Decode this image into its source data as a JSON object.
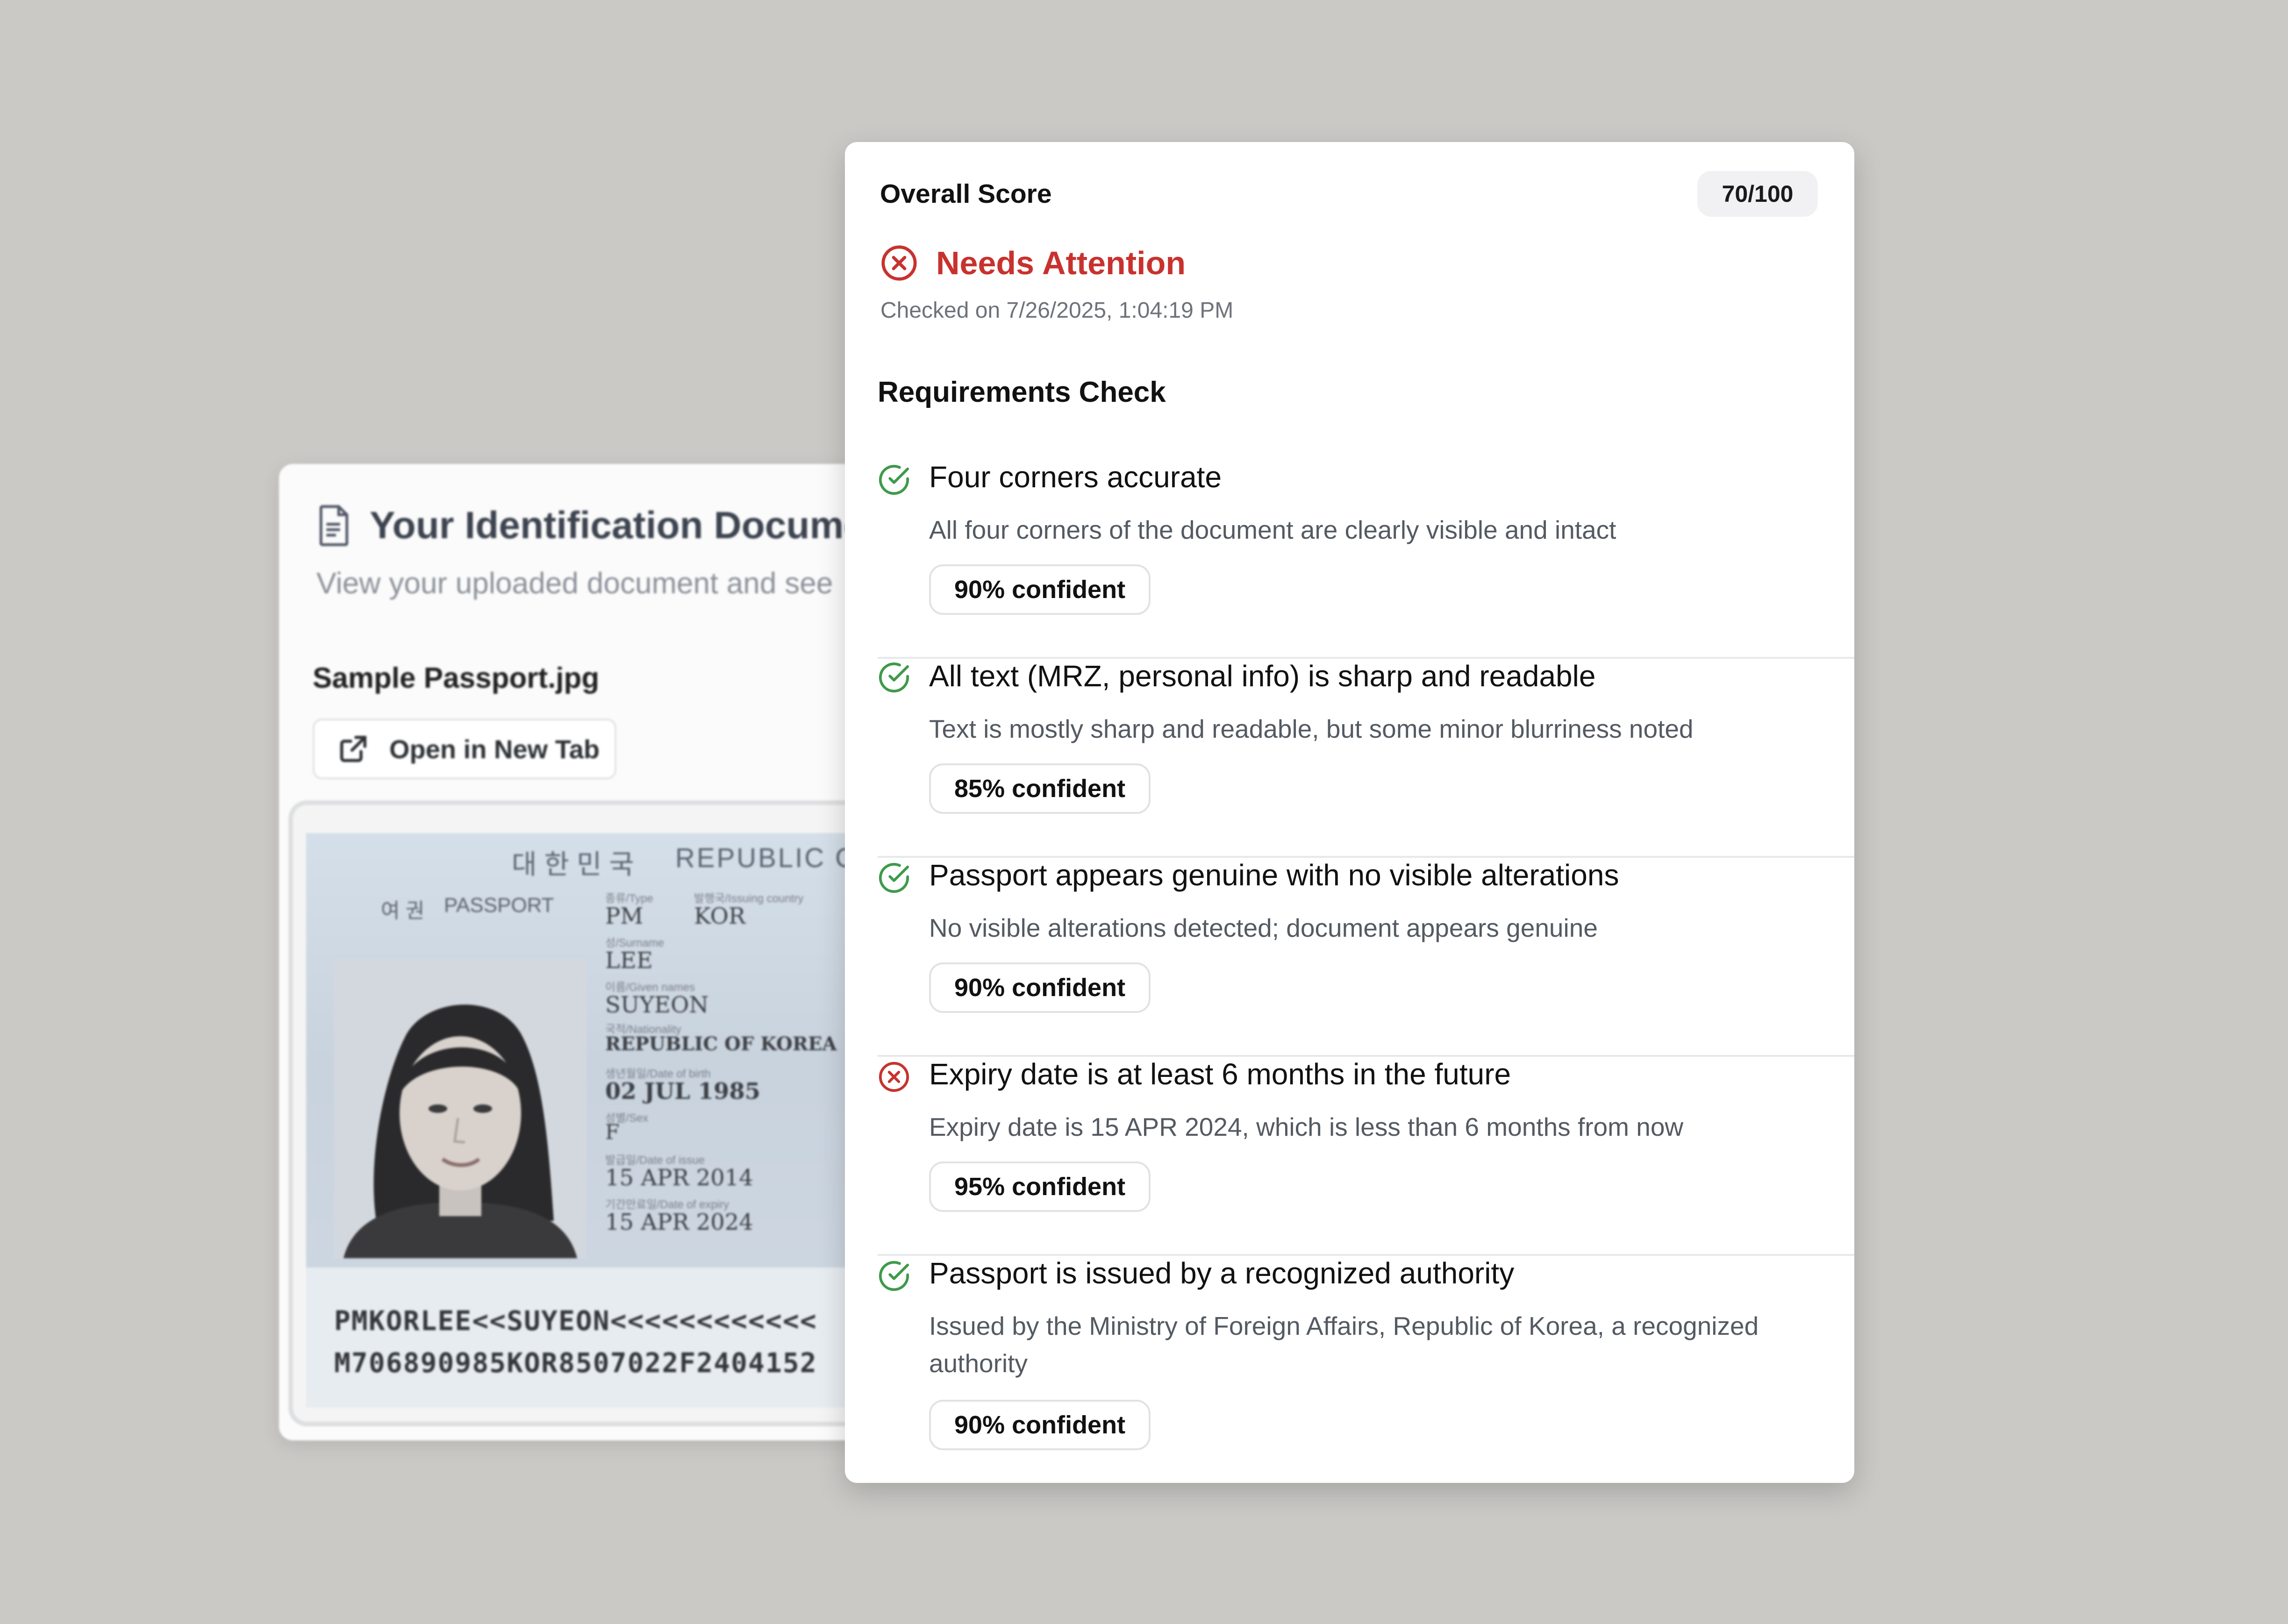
{
  "document_viewer": {
    "title": "Your Identification Document",
    "subtitle": "View your uploaded document and see",
    "file_name": "Sample Passport.jpg",
    "open_button_label": "Open in New Tab",
    "file_icon": "document-icon",
    "open_icon": "external-link-icon",
    "passport": {
      "header_korean": "대 한 민 국",
      "header_english": "REPUBLIC O",
      "label_korean": "여 권",
      "label_english": "PASSPORT",
      "type": "PM",
      "country_code": "KOR",
      "surname": "LEE",
      "given_names": "SUYEON",
      "nationality": "REPUBLIC OF KOREA",
      "date_of_birth": "02 JUL 1985",
      "sex": "F",
      "date_of_issue": "15 APR 2014",
      "date_of_expiry": "15 APR 2024",
      "mrz_line1": "PMKORLEE<<SUYEON<<<<<<<<<<<<",
      "mrz_line2": "M706890985KOR8507022F2404152"
    }
  },
  "results": {
    "score_label": "Overall Score",
    "score": "70/100",
    "status": "Needs Attention",
    "status_icon": "x-circle-icon",
    "status_color": "#c8322e",
    "checked_on": "Checked on 7/26/2025, 1:04:19 PM",
    "requirements_title": "Requirements Check",
    "pass_color": "#3f9a4a",
    "fail_color": "#c8322e",
    "requirements": [
      {
        "name": "Four corners accurate",
        "description": "All four corners of the document are clearly visible and intact",
        "confidence": "90% confident",
        "passed": true,
        "icon": "check-circle-icon"
      },
      {
        "name": "All text (MRZ, personal info) is sharp and readable",
        "description": "Text is mostly sharp and readable, but some minor blurriness noted",
        "confidence": "85% confident",
        "passed": true,
        "icon": "check-circle-icon"
      },
      {
        "name": "Passport appears genuine with no visible alterations",
        "description": "No visible alterations detected; document appears genuine",
        "confidence": "90% confident",
        "passed": true,
        "icon": "check-circle-icon"
      },
      {
        "name": "Expiry date is at least 6 months in the future",
        "description": "Expiry date is 15 APR 2024, which is less than 6 months from now",
        "confidence": "95% confident",
        "passed": false,
        "icon": "x-circle-icon"
      },
      {
        "name": "Passport is issued by a recognized authority",
        "description": "Issued by the Ministry of Foreign Affairs, Republic of Korea, a recognized authority",
        "confidence": "90% confident",
        "passed": true,
        "icon": "check-circle-icon"
      }
    ]
  }
}
